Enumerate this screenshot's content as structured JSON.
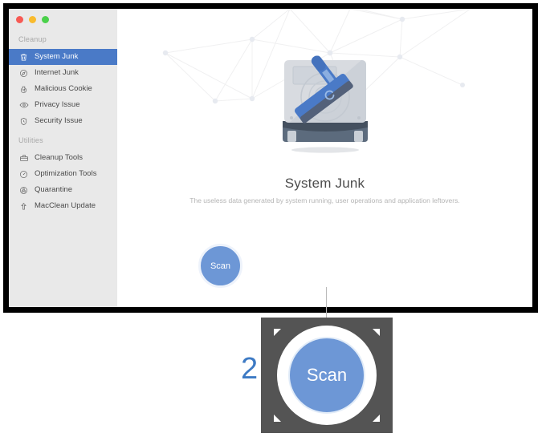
{
  "window": {
    "traffic_lights": [
      {
        "name": "close",
        "color": "#f75a54"
      },
      {
        "name": "minimize",
        "color": "#f9bb2e"
      },
      {
        "name": "zoom",
        "color": "#4bd14b"
      }
    ]
  },
  "sidebar": {
    "sections": [
      {
        "label": "Cleanup",
        "items": [
          {
            "label": "System Junk",
            "icon": "trash-icon",
            "selected": true
          },
          {
            "label": "Internet Junk",
            "icon": "compass-icon",
            "selected": false
          },
          {
            "label": "Malicious Cookie",
            "icon": "cookie-icon",
            "selected": false
          },
          {
            "label": "Privacy Issue",
            "icon": "eye-icon",
            "selected": false
          },
          {
            "label": "Security Issue",
            "icon": "shield-clock-icon",
            "selected": false
          }
        ]
      },
      {
        "label": "Utilities",
        "items": [
          {
            "label": "Cleanup Tools",
            "icon": "toolbox-icon",
            "selected": false
          },
          {
            "label": "Optimization Tools",
            "icon": "gauge-icon",
            "selected": false
          },
          {
            "label": "Quarantine",
            "icon": "biohazard-icon",
            "selected": false
          },
          {
            "label": "MacClean Update",
            "icon": "arrow-up-icon",
            "selected": false
          }
        ]
      }
    ]
  },
  "main": {
    "illustration": "harddrive-with-squeegee-icon",
    "title": "System Junk",
    "subtitle": "The useless data generated by system running, user operations and application leftovers.",
    "scan_button_label": "Scan"
  },
  "callout": {
    "step_number": "2",
    "scan_button_label": "Scan"
  },
  "colors": {
    "accent_blue": "#4a7ac7",
    "scan_blue": "#6d97d6",
    "callout_backdrop": "#545454",
    "sidebar_bg": "#e9e9e9",
    "number_blue": "#3d7ac4"
  }
}
